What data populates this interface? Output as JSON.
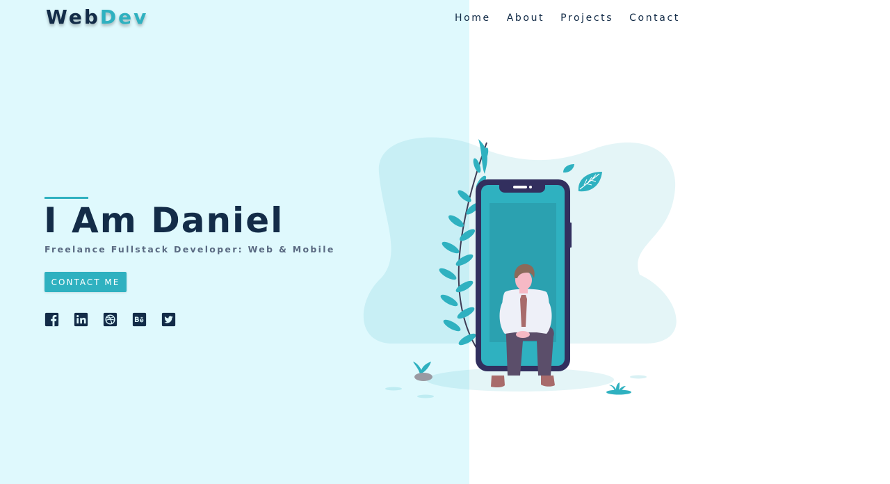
{
  "brand": {
    "part1": "Web",
    "part2": "Dev"
  },
  "nav": {
    "items": [
      {
        "label": "Home"
      },
      {
        "label": "About"
      },
      {
        "label": "Projects"
      },
      {
        "label": "Contact"
      }
    ]
  },
  "hero": {
    "title": "I Am Daniel",
    "subtitle": "Freelance Fullstack Developer: Web & Mobile",
    "cta": "CONTACT ME"
  },
  "social": [
    "facebook-icon",
    "linkedin-icon",
    "dribbble-icon",
    "behance-icon",
    "twitter-icon"
  ],
  "colors": {
    "accent": "#2fb1c0",
    "navy": "#132c48",
    "left_bg": "#dff9fd",
    "phone_frame": "#322f5e"
  }
}
